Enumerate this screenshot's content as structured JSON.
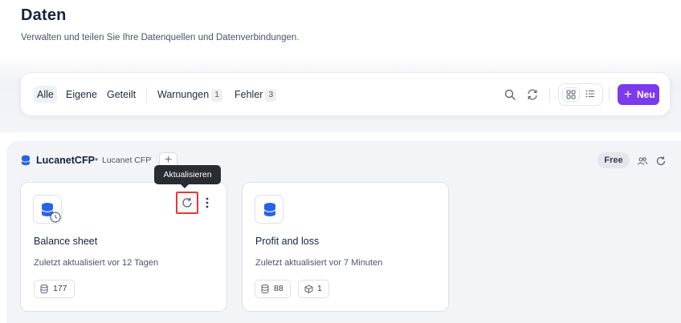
{
  "header": {
    "title": "Daten",
    "subtitle": "Verwalten und teilen Sie Ihre Datenquellen und Datenverbindungen."
  },
  "toolbar": {
    "filters": [
      {
        "label": "Alle",
        "active": true
      },
      {
        "label": "Eigene"
      },
      {
        "label": "Geteilt"
      },
      {
        "label": "Warnungen",
        "count": "1"
      },
      {
        "label": "Fehler",
        "count": "3"
      }
    ],
    "icons": [
      "search-icon",
      "refresh-icon",
      "grid-view-icon",
      "list-view-icon"
    ],
    "new_button": "Neu"
  },
  "section": {
    "title": "LucanetCFP",
    "separator": "•",
    "subtitle": "Lucanet CFP",
    "badge": "Free",
    "add_label": "+"
  },
  "tooltip": "Aktualisieren",
  "cards": [
    {
      "title": "Balance sheet",
      "updated": "Zuletzt aktualisiert vor 12 Tagen",
      "badges": [
        {
          "icon": "database-icon",
          "value": "177"
        }
      ]
    },
    {
      "title": "Profit and loss",
      "updated": "Zuletzt aktualisiert vor 7 Minuten",
      "badges": [
        {
          "icon": "database-icon",
          "value": "88"
        },
        {
          "icon": "cube-icon",
          "value": "1"
        }
      ]
    }
  ],
  "colors": {
    "accent": "#7c3aed",
    "highlight": "#e53935",
    "db_blue": "#2563eb"
  }
}
